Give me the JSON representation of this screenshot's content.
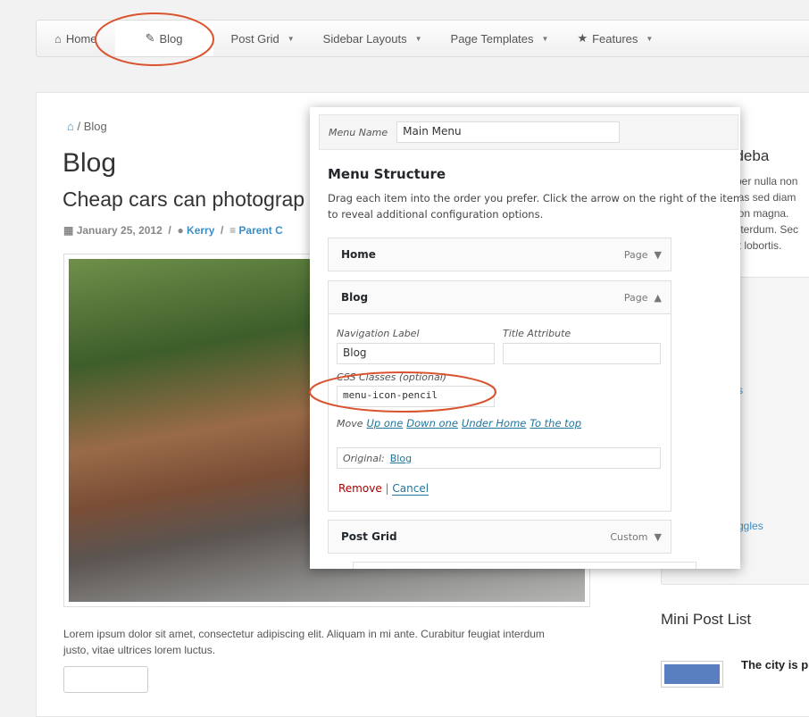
{
  "nav": {
    "items": [
      {
        "label": "Home",
        "icon": "home-icon"
      },
      {
        "label": "Blog",
        "icon": "pencil-icon",
        "active": true
      },
      {
        "label": "Post Grid",
        "dropdown": true
      },
      {
        "label": "Sidebar Layouts",
        "dropdown": true
      },
      {
        "label": "Page Templates",
        "dropdown": true
      },
      {
        "label": "Features",
        "icon": "star-icon",
        "dropdown": true
      }
    ]
  },
  "breadcrumb": {
    "current": "Blog"
  },
  "page": {
    "title": "Blog"
  },
  "post": {
    "title": "Cheap cars can photograp",
    "date": "January 25, 2012",
    "author": "Kerry",
    "category": "Parent C",
    "excerpt": "Lorem ipsum dolor sit amet, consectetur adipiscing elit. Aliquam in mi ante. Curabitur feugiat interdum justo, vitae ultrices lorem luctus."
  },
  "sidebar": {
    "title": "ght Sideba",
    "text": "rper nulla non\nnas sed diam\nnon magna.\ninterdum. Sec\nat lobortis.",
    "link1": "s",
    "link2": "ggles",
    "mini_title": "Mini Post List",
    "mini_post": "The city is p"
  },
  "menu_panel": {
    "menu_name_label": "Menu Name",
    "menu_name_value": "Main Menu",
    "structure_title": "Menu Structure",
    "description": "Drag each item into the order you prefer. Click the arrow on the right of the item to reveal additional configuration options.",
    "items": [
      {
        "label": "Home",
        "type": "Page"
      },
      {
        "label": "Blog",
        "type": "Page"
      },
      {
        "label": "Post Grid",
        "type": "Custom"
      }
    ],
    "nav_label_label": "Navigation Label",
    "nav_label_value": "Blog",
    "title_attr_label": "Title Attribute",
    "title_attr_value": "",
    "css_label": "CSS Classes (optional)",
    "css_value": "menu-icon-pencil",
    "move_label": "Move",
    "move_links": [
      "Up one",
      "Down one",
      "Under Home",
      "To the top"
    ],
    "original_label": "Original:",
    "original_link": "Blog",
    "remove": "Remove",
    "separator": "|",
    "cancel": "Cancel"
  },
  "colors": {
    "link": "#3a8fc7",
    "annotation": "#d9532f",
    "remove": "#a00"
  }
}
